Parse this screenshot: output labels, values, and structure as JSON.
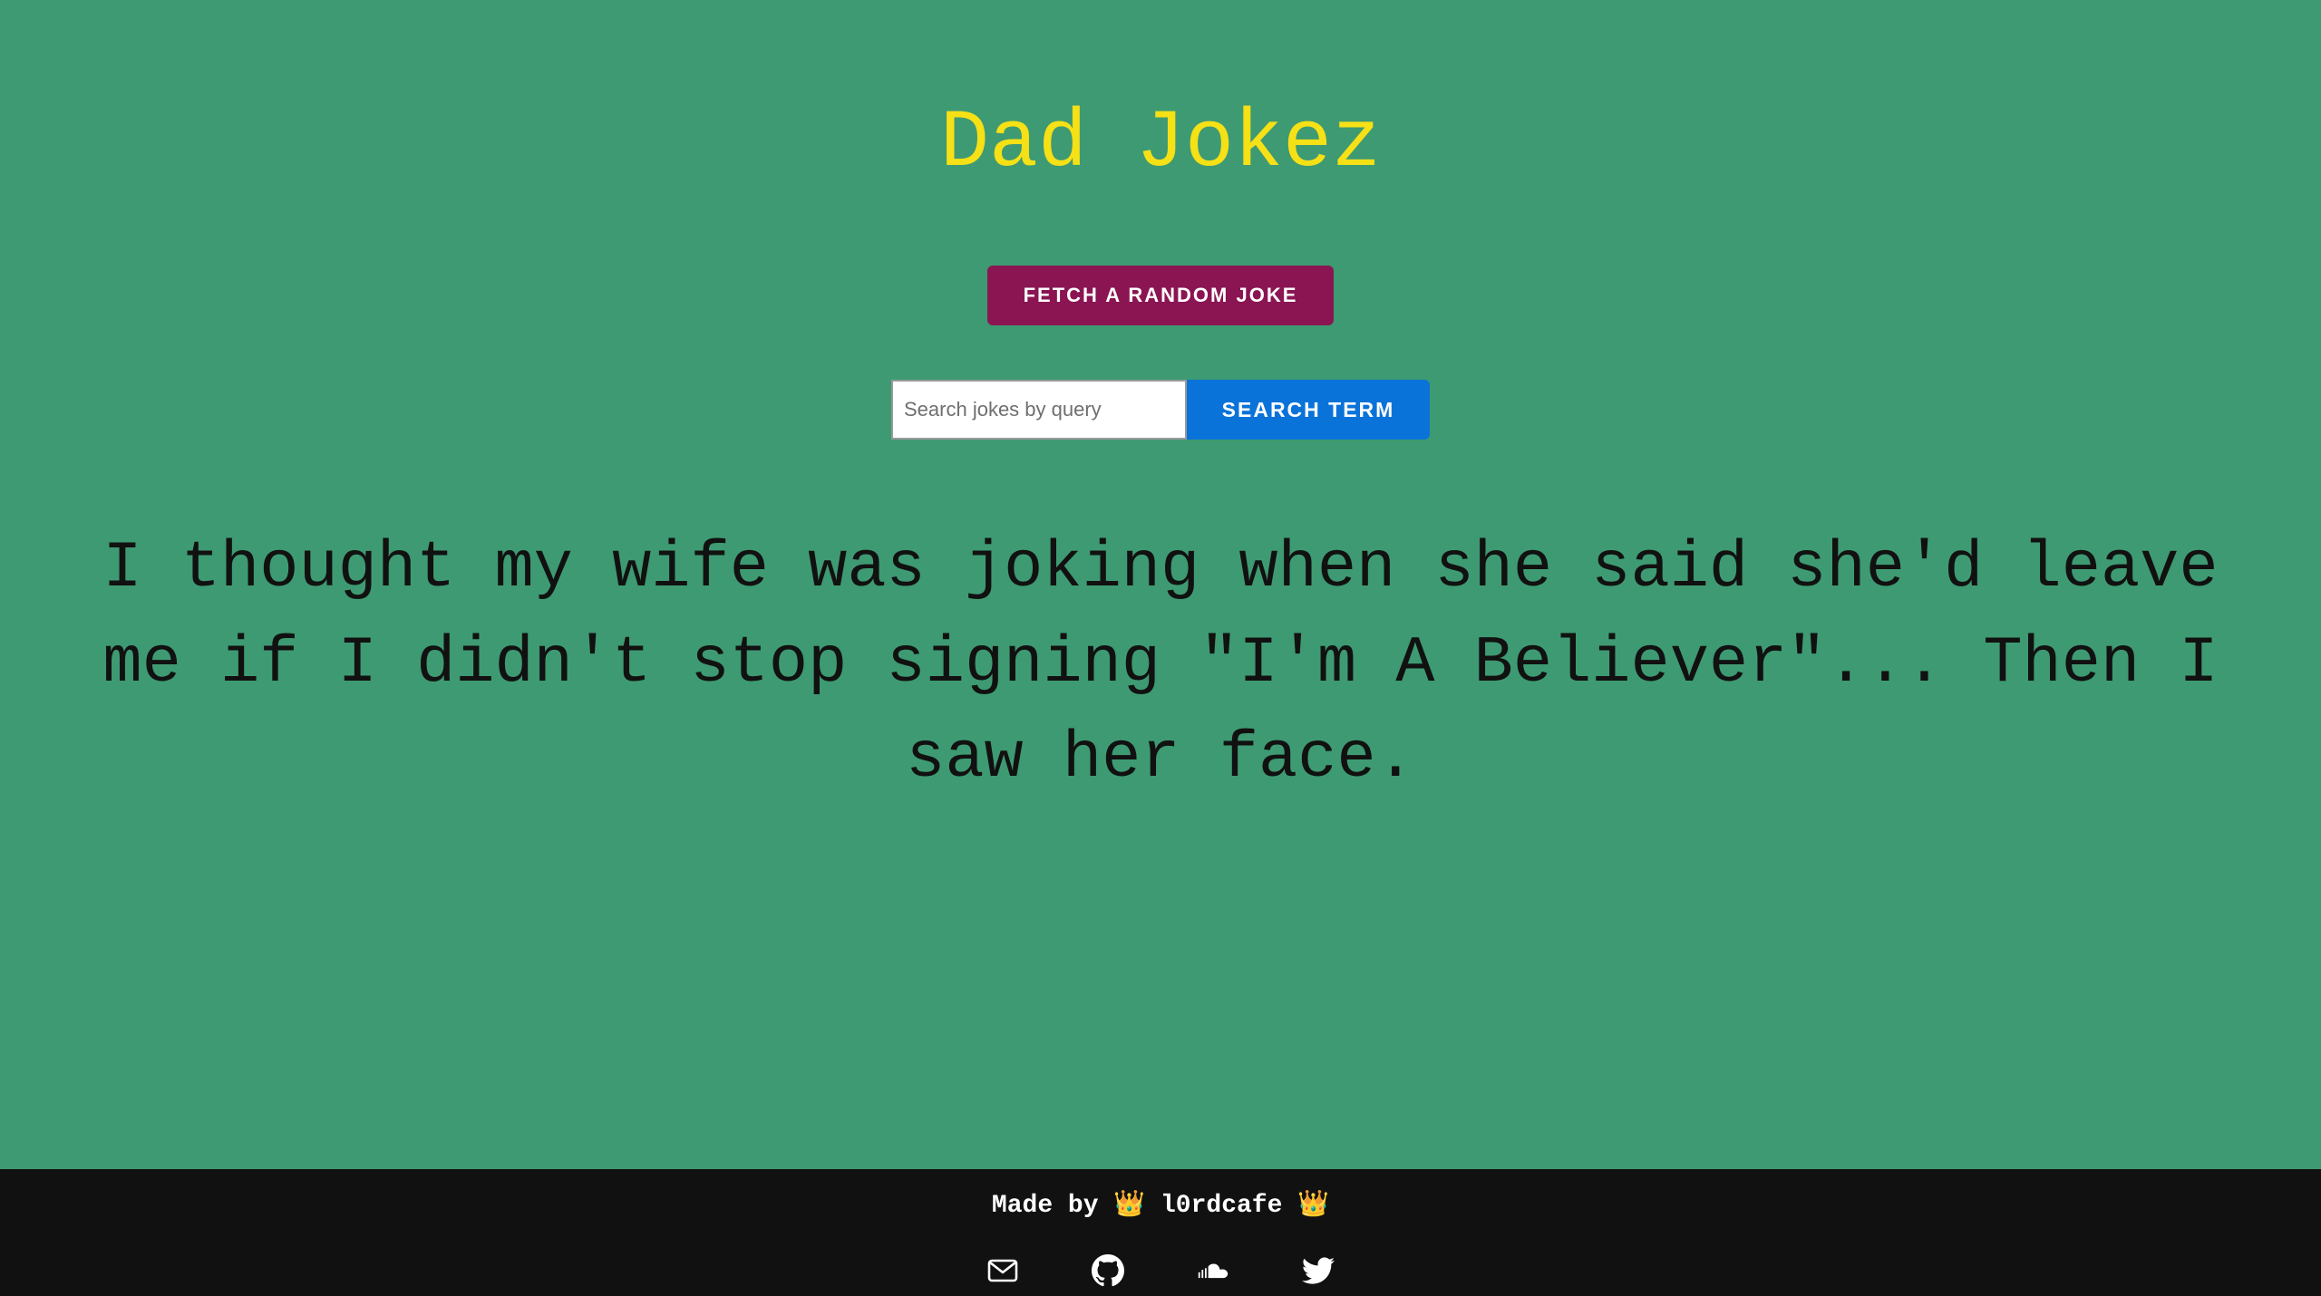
{
  "header": {
    "title": "Dad Jokez"
  },
  "actions": {
    "fetch_label": "FETCH A RANDOM JOKE",
    "fetch_color": "#8a1552"
  },
  "search": {
    "placeholder": "Search jokes by query",
    "value": "",
    "button_label": "SEARCH TERM",
    "button_color": "#0a73d9"
  },
  "joke": {
    "text": "I thought my wife was joking when she said she'd leave me if I didn't stop signing \"I'm A Believer\"... Then I saw her face."
  },
  "footer": {
    "credit": "Made by 👑 l0rdcafe 👑",
    "icons": [
      "mail-icon",
      "github-icon",
      "soundcloud-icon",
      "twitter-icon"
    ]
  },
  "colors": {
    "background": "#3e9a72",
    "title": "#f6e016",
    "footer_bg": "#111111"
  }
}
